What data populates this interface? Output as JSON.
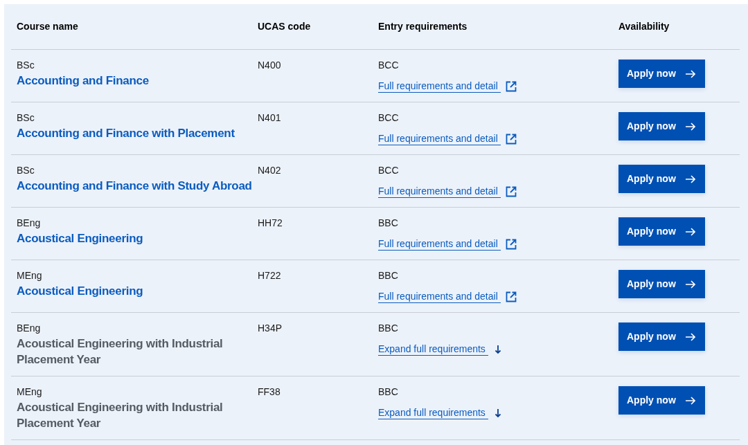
{
  "table": {
    "columns": [
      "Course name",
      "UCAS code",
      "Entry requirements",
      "Availability"
    ],
    "rows": [
      {
        "degree": "BSc",
        "course": "Accounting and Finance",
        "linked": true,
        "ucas": "N400",
        "grades": "BCC",
        "requirements_link": {
          "kind": "external",
          "label": "Full requirements and detail"
        },
        "button": "Apply now"
      },
      {
        "degree": "BSc",
        "course": "Accounting and Finance with Placement",
        "linked": true,
        "ucas": "N401",
        "grades": "BCC",
        "requirements_link": {
          "kind": "external",
          "label": "Full requirements and detail"
        },
        "button": "Apply now"
      },
      {
        "degree": "BSc",
        "course": "Accounting and Finance with Study Abroad",
        "linked": true,
        "ucas": "N402",
        "grades": "BCC",
        "requirements_link": {
          "kind": "external",
          "label": "Full requirements and detail"
        },
        "button": "Apply now"
      },
      {
        "degree": "BEng",
        "course": "Acoustical Engineering",
        "linked": true,
        "ucas": "HH72",
        "grades": "BBC",
        "requirements_link": {
          "kind": "external",
          "label": "Full requirements and detail"
        },
        "button": "Apply now"
      },
      {
        "degree": "MEng",
        "course": "Acoustical Engineering",
        "linked": true,
        "ucas": "H722",
        "grades": "BBC",
        "requirements_link": {
          "kind": "external",
          "label": "Full requirements and detail"
        },
        "button": "Apply now"
      },
      {
        "degree": "BEng",
        "course": "Acoustical Engineering with Industrial Placement Year",
        "linked": false,
        "ucas": "H34P",
        "grades": "BBC",
        "requirements_link": {
          "kind": "expand",
          "label": "Expand full requirements"
        },
        "button": "Apply now"
      },
      {
        "degree": "MEng",
        "course": "Acoustical Engineering with Industrial Placement Year",
        "linked": false,
        "ucas": "FF38",
        "grades": "BBC",
        "requirements_link": {
          "kind": "expand",
          "label": "Expand full requirements"
        },
        "button": "Apply now"
      }
    ]
  }
}
